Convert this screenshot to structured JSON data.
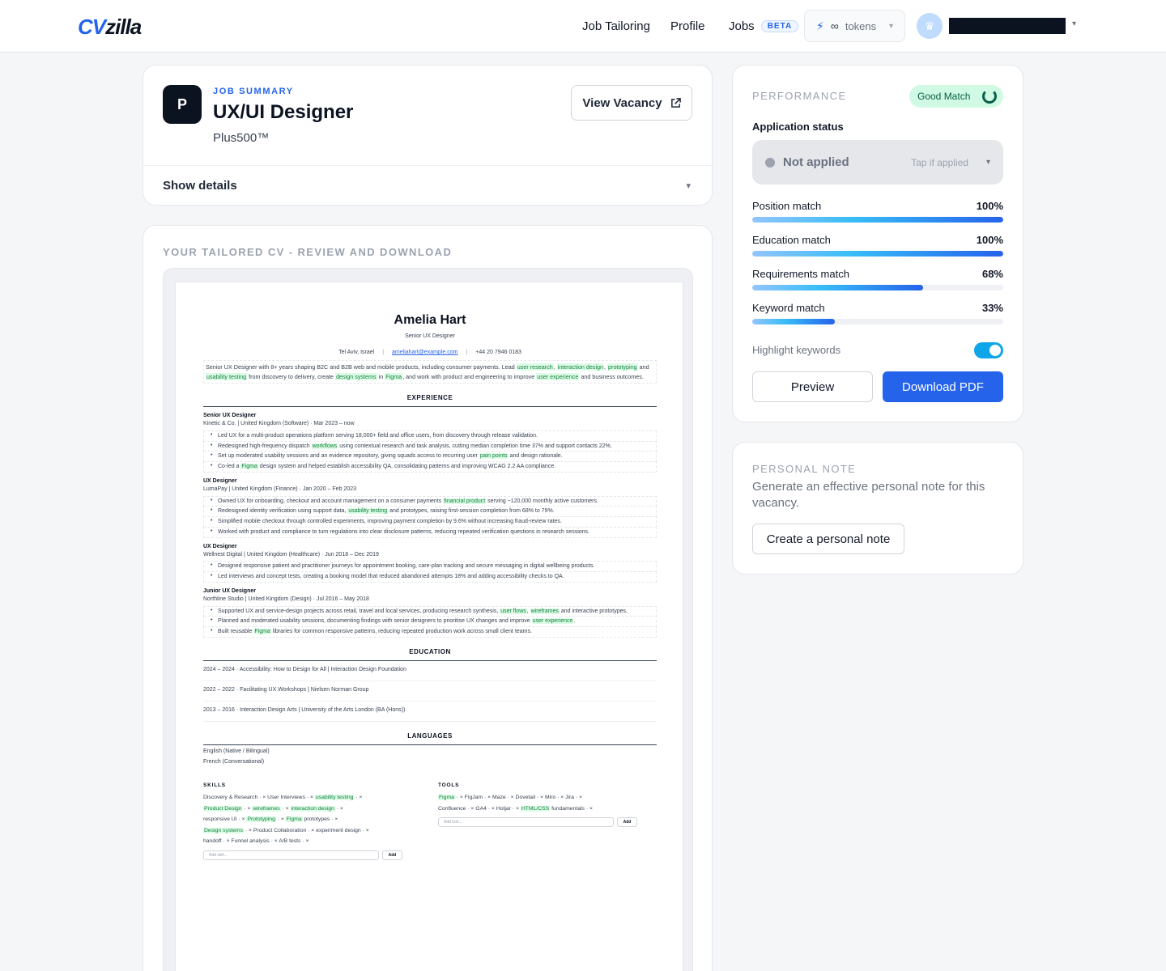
{
  "header": {
    "logo_cv": "CV",
    "logo_zilla": "zilla",
    "nav": [
      "Job Tailoring",
      "Profile",
      "Jobs"
    ],
    "beta": "BETA",
    "tokens_value": "∞",
    "tokens_label": "tokens"
  },
  "job": {
    "icon_letter": "P",
    "eyebrow": "JOB SUMMARY",
    "title": "UX/UI Designer",
    "company": "Plus500™",
    "view_vacancy": "View Vacancy",
    "show_details": "Show details"
  },
  "cv": {
    "section_heading": "YOUR TAILORED CV - REVIEW AND DOWNLOAD",
    "name": "Amelia Hart",
    "role": "Senior UX Designer",
    "location": "Tel Aviv, Israel",
    "email": "ameliahart@example.com",
    "phone": "+44 20 7946 0183",
    "summary_parts": [
      "Senior UX Designer with 8+ years shaping B2C and B2B web and mobile products, including consumer payments. Lead ",
      "user research",
      ", ",
      "interaction design",
      ", ",
      "prototyping",
      " and ",
      "usability testing",
      " from discovery to delivery, create ",
      "design systems",
      " in ",
      "Figma",
      ", and work with product and engineering to improve ",
      "user experience",
      " and business outcomes."
    ],
    "experience_heading": "EXPERIENCE",
    "positions": [
      {
        "title": "Senior UX Designer",
        "meta": "Kinetic & Co. | United Kingdom (Software) · Mar 2023 – now",
        "bullets": [
          [
            "Led UX for a multi-product operations platform serving 18,000+ field and office users, from discovery through release validation."
          ],
          [
            "Redesigned high-frequency dispatch ",
            "workflows",
            " using contextual research and task analysis, cutting median completion time 37% and support contacts 22%."
          ],
          [
            "Set up moderated usability sessions and an evidence repository, giving squads access to recurring user ",
            "pain points",
            " and design rationale."
          ],
          [
            "Co-led a ",
            "Figma",
            " design system and helped establish accessibility QA, consolidating patterns and improving WCAG 2.2 AA compliance."
          ]
        ]
      },
      {
        "title": "UX Designer",
        "meta": "LumaPay | United Kingdom (Finance) · Jan 2020 – Feb 2023",
        "bullets": [
          [
            "Owned UX for onboarding, checkout and account management on a consumer payments ",
            "financial product",
            " serving ~120,000 monthly active customers."
          ],
          [
            "Redesigned identity verification using support data, ",
            "usability testing",
            " and prototypes, raising first-session completion from 68% to 79%."
          ],
          [
            "Simplified mobile checkout through controlled experiments, improving payment completion by 9.6% without increasing fraud-review rates."
          ],
          [
            "Worked with product and compliance to turn regulations into clear disclosure patterns, reducing repeated verification questions in research sessions."
          ]
        ]
      },
      {
        "title": "UX Designer",
        "meta": "Wellnest Digital | United Kingdom (Healthcare) · Jun 2018 – Dec 2019",
        "bullets": [
          [
            "Designed responsive patient and practitioner journeys for appointment booking, care-plan tracking and secure messaging in digital wellbeing products."
          ],
          [
            "Led interviews and concept tests, creating a booking model that reduced abandoned attempts 18% and adding accessibility checks to QA."
          ]
        ]
      },
      {
        "title": "Junior UX Designer",
        "meta": "Northline Studio | United Kingdom (Design) · Jul 2016 – May 2018",
        "bullets": [
          [
            "Supported UX and service-design projects across retail, travel and local services, producing research synthesis, ",
            "user flows",
            ", ",
            "wireframes",
            " and interactive prototypes."
          ],
          [
            "Planned and moderated usability sessions, documenting findings with senior designers to prioritise UX changes and improve ",
            "user experience",
            "."
          ],
          [
            "Built reusable ",
            "Figma",
            " libraries for common responsive patterns, reducing repeated production work across small client teams."
          ]
        ]
      }
    ],
    "education_heading": "EDUCATION",
    "education": [
      "2024 – 2024 · Accessibility: How to Design for All | Interaction Design Foundation",
      "2022 – 2022 · Facilitating UX Workshops | Nielsen Norman Group",
      "2013 – 2016 · Interaction Design Arts | University of the Arts London (BA (Hons))"
    ],
    "languages_heading": "LANGUAGES",
    "languages": [
      "English (Native / Bilingual)",
      "French (Conversational)"
    ],
    "skills_heading": "SKILLS",
    "skills_rows": [
      [
        "Discovery & Research",
        "User Interviews",
        "usability testing"
      ],
      [
        "Product Design",
        "wireframes",
        "interaction design"
      ],
      [
        "responsive UI",
        "Prototyping",
        "Figma prototypes"
      ],
      [
        "Design systems",
        "Product Collaboration",
        "experiment design"
      ],
      [
        "handoff",
        "Funnel analysis",
        "A/B tests"
      ]
    ],
    "add_skill_placeholder": "Add skill...",
    "tools_heading": "TOOLS",
    "tools_rows": [
      [
        "Figma",
        "FigJam",
        "Maze",
        "Dovetail",
        "Miro",
        "Jira"
      ],
      [
        "Confluence",
        "GA4",
        "Hotjar",
        "HTML/CSS fundamentals"
      ]
    ],
    "add_tool_placeholder": "Add tool...",
    "add_label": "Add"
  },
  "performance": {
    "heading": "PERFORMANCE",
    "match_badge": "Good Match",
    "status_label": "Application status",
    "status_value": "Not applied",
    "status_hint": "Tap if applied",
    "metrics": [
      {
        "label": "Position match",
        "display": "100%",
        "value": 100
      },
      {
        "label": "Education match",
        "display": "100%",
        "value": 100
      },
      {
        "label": "Requirements match",
        "display": "68%",
        "value": 68
      },
      {
        "label": "Keyword match",
        "display": "33%",
        "value": 33
      }
    ],
    "highlight_label": "Highlight keywords",
    "highlight_on": true,
    "preview": "Preview",
    "download": "Download PDF"
  },
  "note": {
    "heading": "PERSONAL NOTE",
    "desc": "Generate an effective personal note for this vacancy.",
    "button": "Create a personal note"
  },
  "colors": {
    "accent": "#2563eb",
    "keyword_bg": "#dcfce7",
    "good_match_bg": "#d1fae5"
  }
}
